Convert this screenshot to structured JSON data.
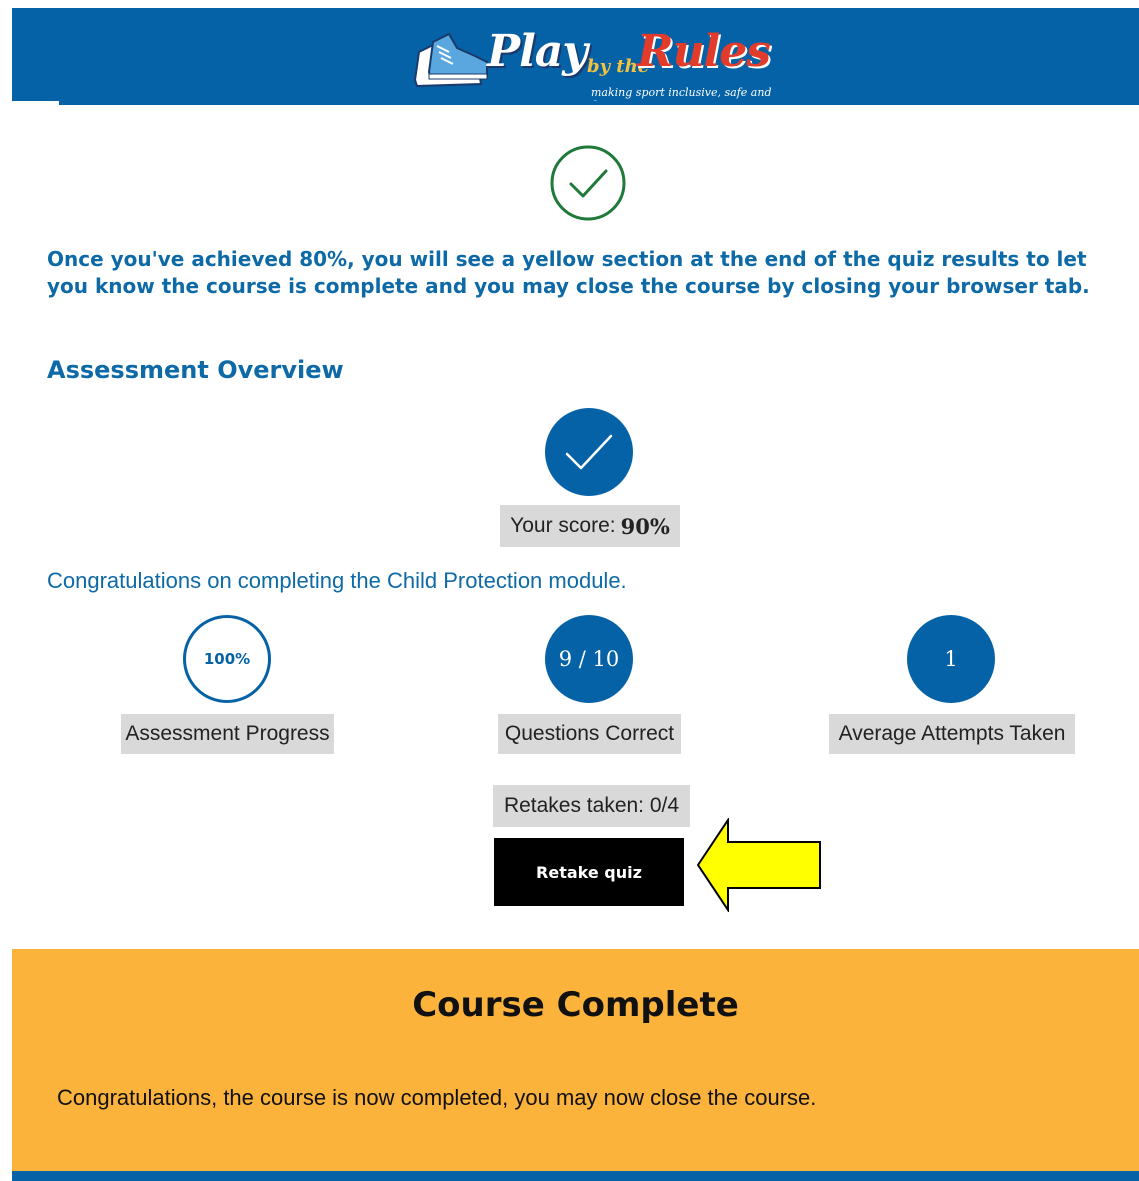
{
  "header": {
    "logo": {
      "word1": "Play",
      "word2": "by the",
      "word3": "Rules",
      "tagline": "making sport inclusive, safe and fair."
    }
  },
  "intro_text": "Once you've achieved 80%, you will see a yellow section at the end of the quiz results to let you know the course is complete and you may close the course by closing your browser tab.",
  "overview": {
    "title": "Assessment Overview",
    "score_label": "Your score:",
    "score_value": "90%",
    "congrats": "Congratulations on completing the Child Protection module.",
    "stats": [
      {
        "value": "100%",
        "label": "Assessment Progress",
        "progress_fraction": 1.0
      },
      {
        "value": "9 / 10",
        "label": "Questions Correct"
      },
      {
        "value": "1",
        "label": "Average Attempts Taken"
      }
    ],
    "retakes": "Retakes taken: 0/4",
    "retake_button": "Retake quiz"
  },
  "course_complete": {
    "title": "Course Complete",
    "message": "Congratulations, the course is now completed, you may now close the course."
  },
  "colors": {
    "brand_blue": "#0562a6",
    "text_blue": "#0e6aa6",
    "complete_orange": "#fbb33b",
    "check_green": "#1f7a3a",
    "annotation_yellow": "#ffff00"
  },
  "icons": {
    "top_check": "check-circle-outline-icon",
    "score_check": "check-circle-filled-icon",
    "annotation": "arrow-left-icon"
  }
}
